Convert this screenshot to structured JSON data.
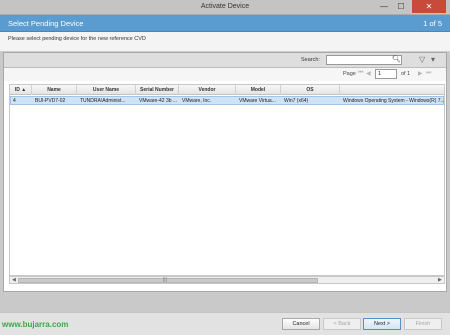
{
  "window": {
    "title": "Activate Device",
    "minimize_glyph": "—",
    "maximize_glyph": "☐",
    "close_glyph": "✕"
  },
  "header": {
    "title": "Select Pending Device",
    "pager": "1 of 5"
  },
  "instructions": "Please select pending device for the new reference CVD",
  "search": {
    "label": "Search:",
    "value": "",
    "icon": "magnifier-icon",
    "filter_icon": "filter-icon"
  },
  "pagination": {
    "page_label": "Page",
    "page_value": "1",
    "of_label": "of 1"
  },
  "table": {
    "columns": [
      "ID ▲",
      "Name",
      "User Name",
      "Serial Number",
      "Vendor",
      "Model",
      "OS"
    ],
    "rows": [
      [
        "4",
        "BUI-PVD7-02",
        "TUNDRA\\Administ...",
        "VMware-42 3b ...",
        "VMware, Inc.",
        "VMware Virtua...",
        "Win7 (x64)",
        "Windows Operating System - Windows(R) 7..."
      ]
    ]
  },
  "scrollbar": {
    "left_arrow": "◀",
    "right_arrow": "▶",
    "grip": "|||"
  },
  "footer": {
    "cancel": "Cancel",
    "back": "< Back",
    "next": "Next >",
    "finish": "Finish"
  },
  "watermark": "www.bujarra.com"
}
